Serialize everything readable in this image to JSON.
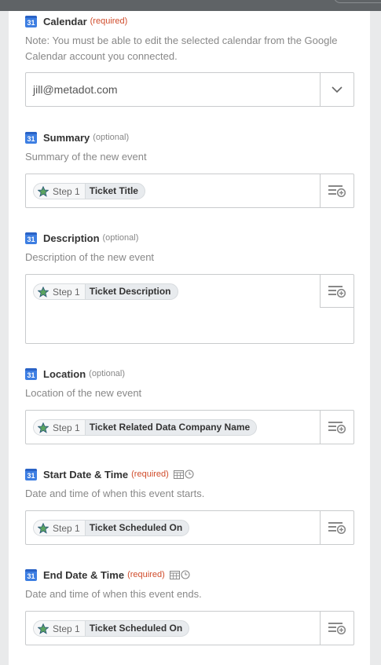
{
  "fields": [
    {
      "label": "Calendar",
      "tag": "(required)",
      "help": "Note: You must be able to edit the selected calendar from the Google Calendar account you connected.",
      "value": "jill@metadot.com"
    },
    {
      "label": "Summary",
      "tag": "(optional)",
      "help": "Summary of the new event",
      "step": "Step 1",
      "value": "Ticket Title"
    },
    {
      "label": "Description",
      "tag": "(optional)",
      "help": "Description of the new event",
      "step": "Step 1",
      "value": "Ticket Description"
    },
    {
      "label": "Location",
      "tag": "(optional)",
      "help": "Location of the new event",
      "step": "Step 1",
      "value": "Ticket Related Data Company Name"
    },
    {
      "label": "Start Date & Time",
      "tag": "(required)",
      "help": "Date and time of when this event starts.",
      "step": "Step 1",
      "value": "Ticket Scheduled On"
    },
    {
      "label": "End Date & Time",
      "tag": "(required)",
      "help": "Date and time of when this event ends.",
      "step": "Step 1",
      "value": "Ticket Scheduled On"
    }
  ],
  "calendar_icon_number": "31",
  "icons": {
    "app": "google-calendar-icon",
    "dropdown": "chevron-down-icon",
    "insert_field": "insert-field-icon",
    "step": "zapier-step-star-icon",
    "datetime": "calendar-clock-icon"
  },
  "colors": {
    "required": "#d04c2b",
    "optional": "#888888",
    "calendar_blue": "#3d7ee2",
    "chip_bg": "#e8ebee"
  }
}
